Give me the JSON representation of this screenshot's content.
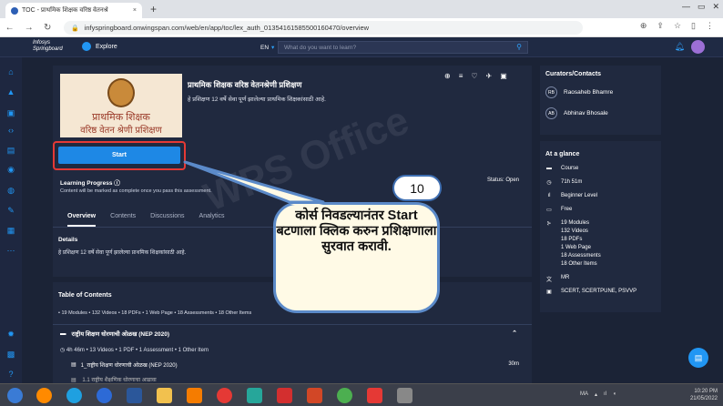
{
  "browser": {
    "tab_title": "TOC - प्राथमिक शिक्षक वरिष्ठ वेतनश्रे",
    "tab_close": "×",
    "new_tab": "+",
    "url": "infyspringboard.onwingspan.com/web/en/app/toc/lex_auth_01354161585500160470/overview",
    "win_min": "—",
    "win_max": "▭",
    "win_close": "✕"
  },
  "appbar": {
    "logo_line1": "Infosys",
    "logo_line2": "Springboard",
    "explore_label": "Explore",
    "lang": "EN",
    "search_placeholder": "What do you want to learn?"
  },
  "course": {
    "thumb_line1": "प्राथमिक शिक्षक",
    "thumb_line2": "वरिष्ठ वेतन श्रेणी प्रशिक्षण",
    "title": "प्राथमिक शिक्षक वरिष्ठ वेतनश्रेणी प्रशिक्षण",
    "subtitle": "हे प्रशिक्षण 12 वर्षे सेवा पूर्ण झालेल्या प्राथमिक शिक्षकांसाठी आहे.",
    "start_label": "Start",
    "learning_progress": "Learning Progress ⓘ",
    "progress_note": "Content will be marked as complete once you pass this assessment.",
    "status": "Status: Open",
    "tabs": [
      "Overview",
      "Contents",
      "Discussions",
      "Analytics"
    ],
    "details_label": "Details",
    "details_text": "हे प्रशिक्षण 12 वर्षे सेवा पूर्ण झालेल्या प्राथमिक शिक्षकांसाठी आहे."
  },
  "toc": {
    "title": "Table of Contents",
    "summary": "• 19 Modules • 132 Videos • 18 PDFs • 1 Web Page • 18 Assessments • 18 Other Items",
    "module_title": "राष्ट्रीय शिक्षण धोरणाची ओळख (NEP 2020)",
    "module_meta": "4h 46m • 13 Videos • 1 PDF • 1 Assessment • 1 Other Item",
    "item1_title": "1_राष्ट्रीय शिक्षण धोरणाची ओळख (NEP 2020)",
    "item1_duration": "30m",
    "item2_title": "1.1 राष्ट्रीय शैक्षणिक धोरणाचा आढावा"
  },
  "curators": {
    "title": "Curators/Contacts",
    "people": [
      {
        "initials": "RB",
        "name": "Raosaheb Bhamre"
      },
      {
        "initials": "AB",
        "name": "Abhinav Bhosale"
      }
    ]
  },
  "glance": {
    "title": "At a glance",
    "items": [
      "Course",
      "71h 51m",
      "Beginner Level",
      "Free",
      "19 Modules"
    ],
    "module_details": [
      "132 Videos",
      "18 PDFs",
      "1 Web Page",
      "18 Assessments",
      "18 Other Items"
    ],
    "lang": "MR",
    "tags": "SCERT, SCERTPUNE, PSVVP"
  },
  "annotation": {
    "number": "10",
    "text": "कोर्स निवडल्यानंतर Start बटणाला क्लिक करुन प्रशिक्षणाला सुरवात करावी."
  },
  "watermark": "WPS Office",
  "taskbar": {
    "lang": "MA",
    "time": "10:20 PM",
    "date": "21/05/2022"
  },
  "colors": {
    "accent": "#1e88e5",
    "highlight": "#e53935",
    "bg": "#1b2336",
    "panel": "#20293f"
  }
}
